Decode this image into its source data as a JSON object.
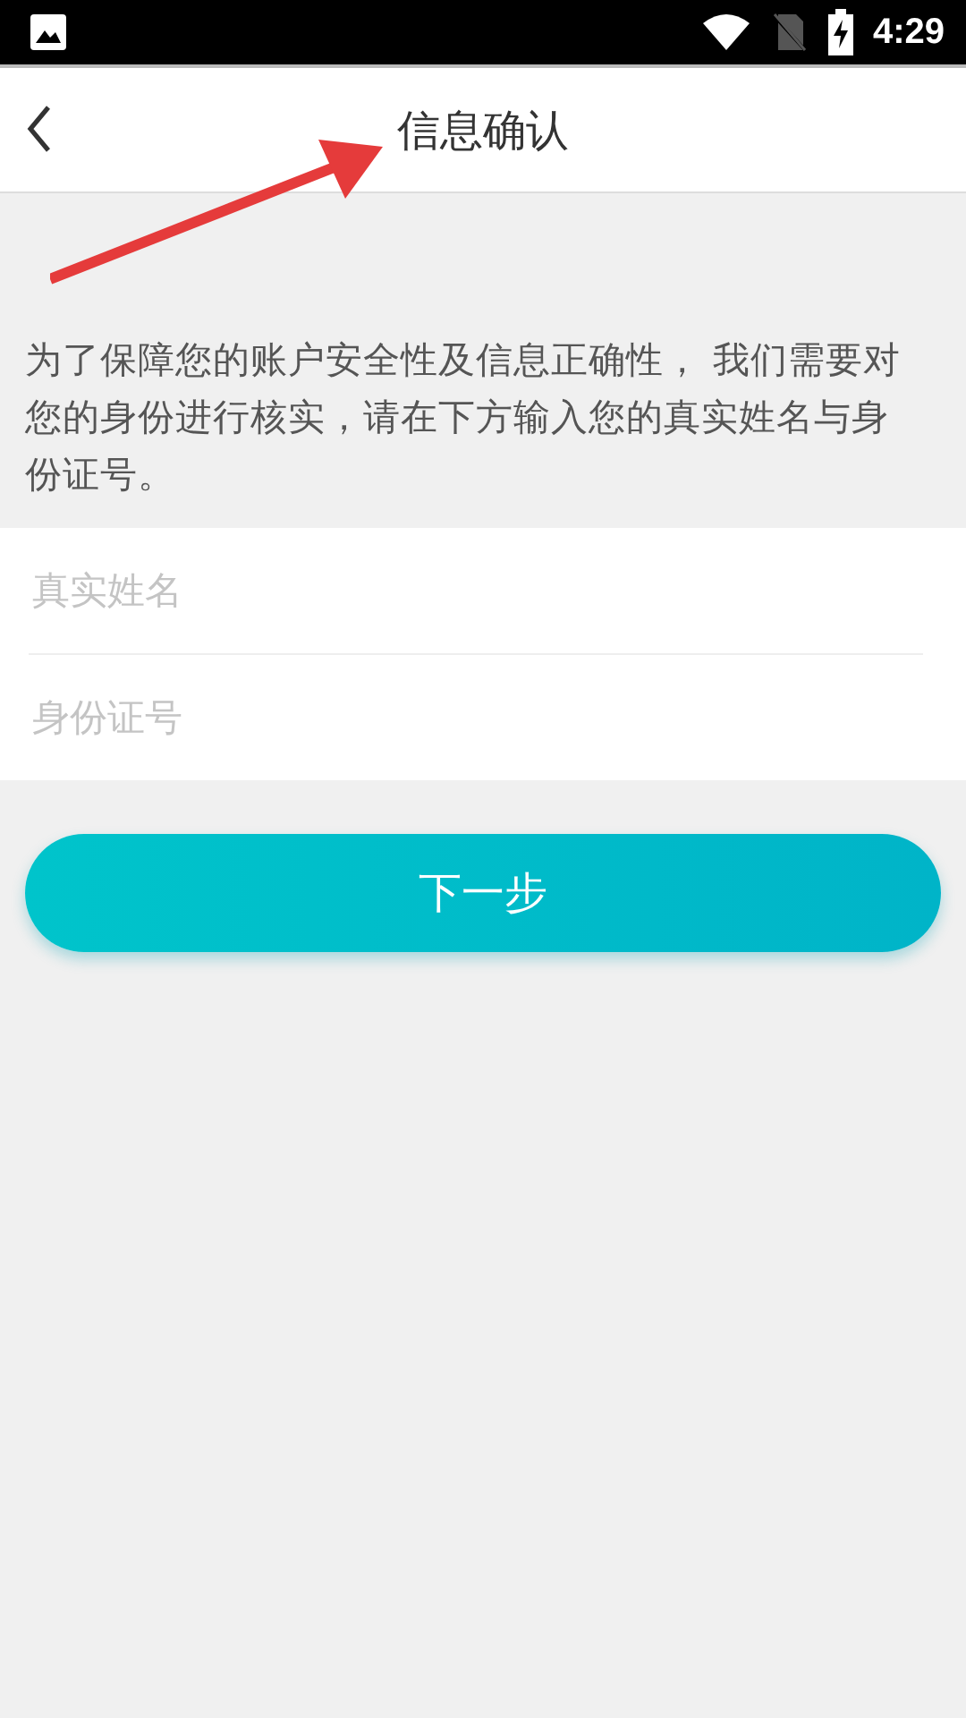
{
  "status_bar": {
    "time": "4:29"
  },
  "header": {
    "title": "信息确认"
  },
  "notice": "为了保障您的账户安全性及信息正确性， 我们需要对您的身份进行核实，请在下方输入您的真实姓名与身份证号。",
  "fields": [
    {
      "placeholder": "真实姓名"
    },
    {
      "placeholder": "身份证号"
    }
  ],
  "next_button": "下一步"
}
